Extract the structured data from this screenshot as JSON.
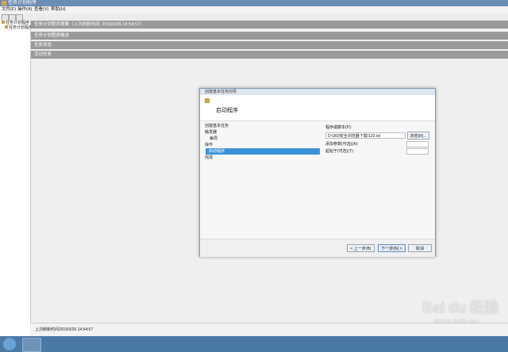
{
  "window": {
    "title": "任务计划程序"
  },
  "menu": {
    "file": "文件(F)",
    "action": "操作(A)",
    "view": "查看(V)",
    "help": "帮助(H)"
  },
  "sidebar": {
    "items": [
      {
        "label": "任务计划程序"
      },
      {
        "label": "任务计划程序库"
      }
    ]
  },
  "main": {
    "header": "任务计划程序摘要（上次刷新时间: 2019/3/26 14:54:57）",
    "sections": [
      {
        "label": "任务计划程序概述"
      },
      {
        "label": "任务状态"
      },
      {
        "label": "活动任务"
      }
    ]
  },
  "status": {
    "text": "上次刷新时间2019/3/26 14:54:57"
  },
  "dialog": {
    "title": "创建基本任务向导",
    "heading": "启动程序",
    "steps": [
      {
        "label": "创建基本任务"
      },
      {
        "label": "触发器"
      },
      {
        "label": "每周"
      },
      {
        "label": "操作"
      },
      {
        "label": "启动程序",
        "active": true
      },
      {
        "label": "完成"
      }
    ],
    "fields": {
      "program_label": "程序或脚本(P):",
      "program_value": "D:\\360安全浏览器下载\\123.txt",
      "browse_label": "浏览(R)...",
      "args_label": "添加参数(可选)(A):",
      "args_value": "",
      "start_label": "起始于(可选)(T):",
      "start_value": ""
    },
    "buttons": {
      "back": "< 上一步(B)",
      "next": "下一步(N) >",
      "cancel": "取消"
    }
  },
  "watermark": {
    "brand": "Bai du 经验",
    "sub": "jingyan.baidu.com"
  }
}
